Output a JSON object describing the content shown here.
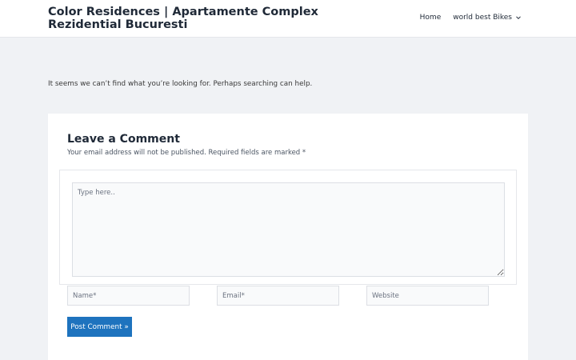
{
  "site": {
    "title": "Color Residences | Apartamente Complex Rezidential Bucuresti"
  },
  "nav": {
    "items": [
      {
        "label": "Home"
      },
      {
        "label": "world best Bikes",
        "icon": "chevron-down-icon"
      }
    ]
  },
  "main": {
    "not_found_text": "It seems we can’t find what you’re looking for. Perhaps searching can help."
  },
  "comment": {
    "title": "Leave a Comment",
    "note": "Your email address will not be published. Required fields are marked *",
    "textarea_placeholder": "Type here..",
    "name_placeholder": "Name*",
    "email_placeholder": "Email*",
    "website_placeholder": "Website",
    "submit_label": "Post Comment »"
  },
  "colors": {
    "accent": "#1e73be",
    "background": "#f0f2f5"
  }
}
